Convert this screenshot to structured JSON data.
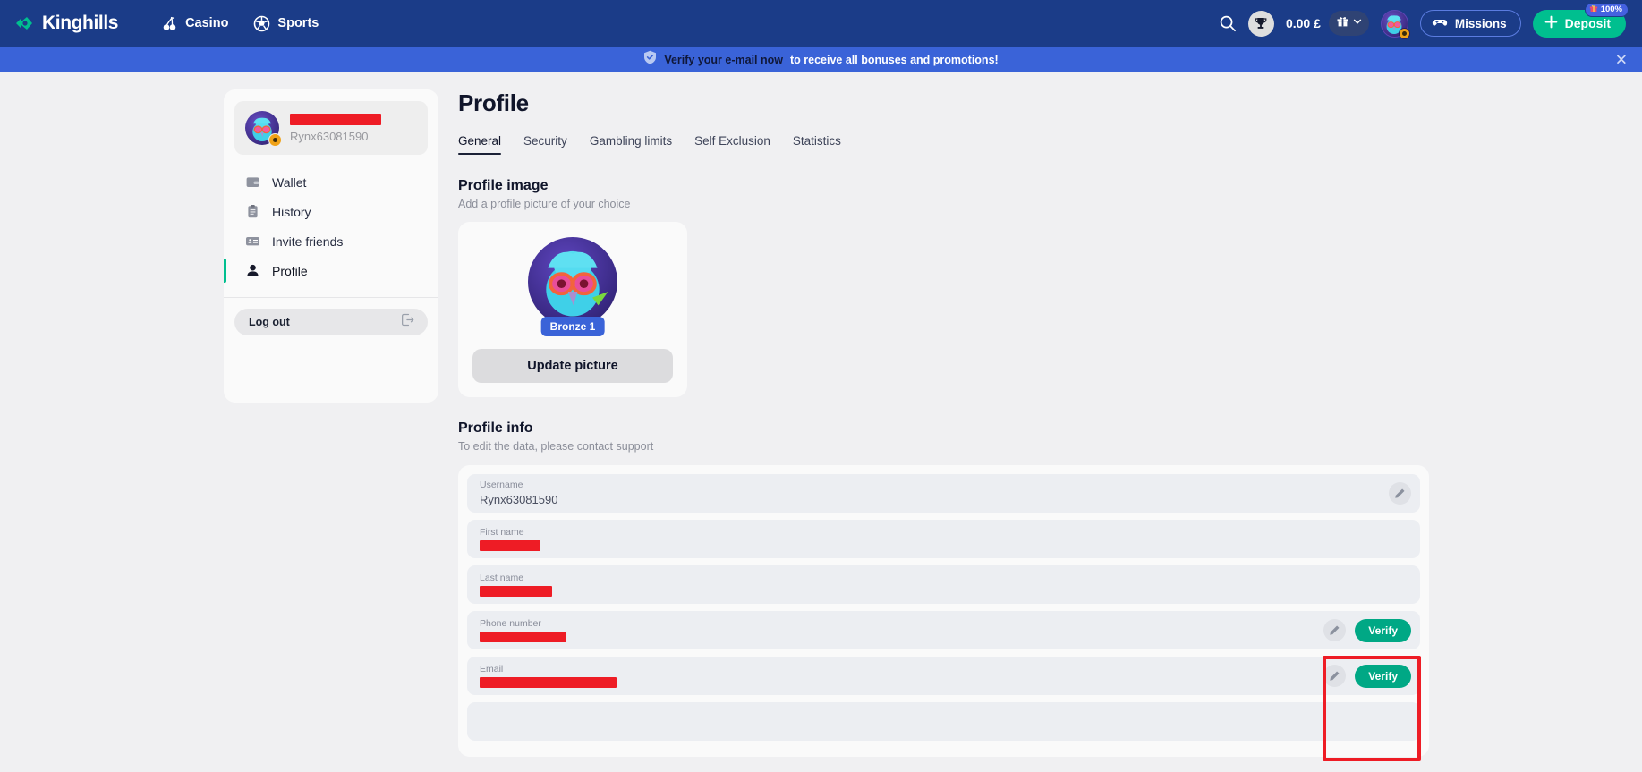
{
  "header": {
    "brand": "Kinghills",
    "nav": [
      {
        "label": "Casino",
        "icon": "cherries-icon"
      },
      {
        "label": "Sports",
        "icon": "football-icon"
      }
    ],
    "search_icon": "search-icon",
    "trophy_icon": "trophy-icon",
    "balance": "0.00 £",
    "gift_icon": "gift-icon",
    "chevron_icon": "chevron-down-icon",
    "avatar_icon": "user-avatar",
    "missions_label": "Missions",
    "missions_icon": "gamepad-icon",
    "deposit_label": "Deposit",
    "deposit_badge": "100%",
    "deposit_badge_icon": "gift-box-icon",
    "colors": {
      "header_bg": "#1b3c88",
      "accent_green": "#00bf8f",
      "banner_blue": "#3a63d8"
    }
  },
  "banner": {
    "shield_icon": "shield-check-icon",
    "strong_text": "Verify your e-mail now",
    "rest_text": "to receive all bonuses and promotions!",
    "close_icon": "close-icon"
  },
  "sidebar": {
    "profile_card": {
      "avatar": "user-avatar",
      "display_name_redacted": true,
      "username": "Rynx63081590"
    },
    "items": [
      {
        "label": "Wallet",
        "icon": "wallet-icon",
        "active": false
      },
      {
        "label": "History",
        "icon": "clipboard-icon",
        "active": false
      },
      {
        "label": "Invite friends",
        "icon": "id-card-icon",
        "active": false
      },
      {
        "label": "Profile",
        "icon": "person-icon",
        "active": true
      }
    ],
    "logout": {
      "label": "Log out",
      "icon": "logout-icon"
    }
  },
  "main": {
    "title": "Profile",
    "tabs": [
      {
        "label": "General",
        "active": true
      },
      {
        "label": "Security",
        "active": false
      },
      {
        "label": "Gambling limits",
        "active": false
      },
      {
        "label": "Self Exclusion",
        "active": false
      },
      {
        "label": "Statistics",
        "active": false
      }
    ],
    "profile_image": {
      "heading": "Profile image",
      "subtext": "Add a profile picture of your choice",
      "rank_badge": "Bronze 1",
      "update_button": "Update picture"
    },
    "profile_info": {
      "heading": "Profile info",
      "subtext": "To edit the data, please contact support",
      "edit_icon": "pencil-icon",
      "verify_label": "Verify",
      "fields": [
        {
          "label": "Username",
          "value": "Rynx63081590",
          "redacted": false,
          "redact_width": 0,
          "edit": true,
          "verify": false
        },
        {
          "label": "First name",
          "value": "",
          "redacted": true,
          "redact_width": 68,
          "edit": false,
          "verify": false
        },
        {
          "label": "Last name",
          "value": "",
          "redacted": true,
          "redact_width": 81,
          "edit": false,
          "verify": false
        },
        {
          "label": "Phone number",
          "value": "",
          "redacted": true,
          "redact_width": 97,
          "edit": true,
          "verify": true
        },
        {
          "label": "Email",
          "value": "",
          "redacted": true,
          "redact_width": 153,
          "edit": true,
          "verify": true
        }
      ]
    }
  },
  "annotation": {
    "color": "#ee1c25",
    "label": "verify-buttons-highlight"
  }
}
